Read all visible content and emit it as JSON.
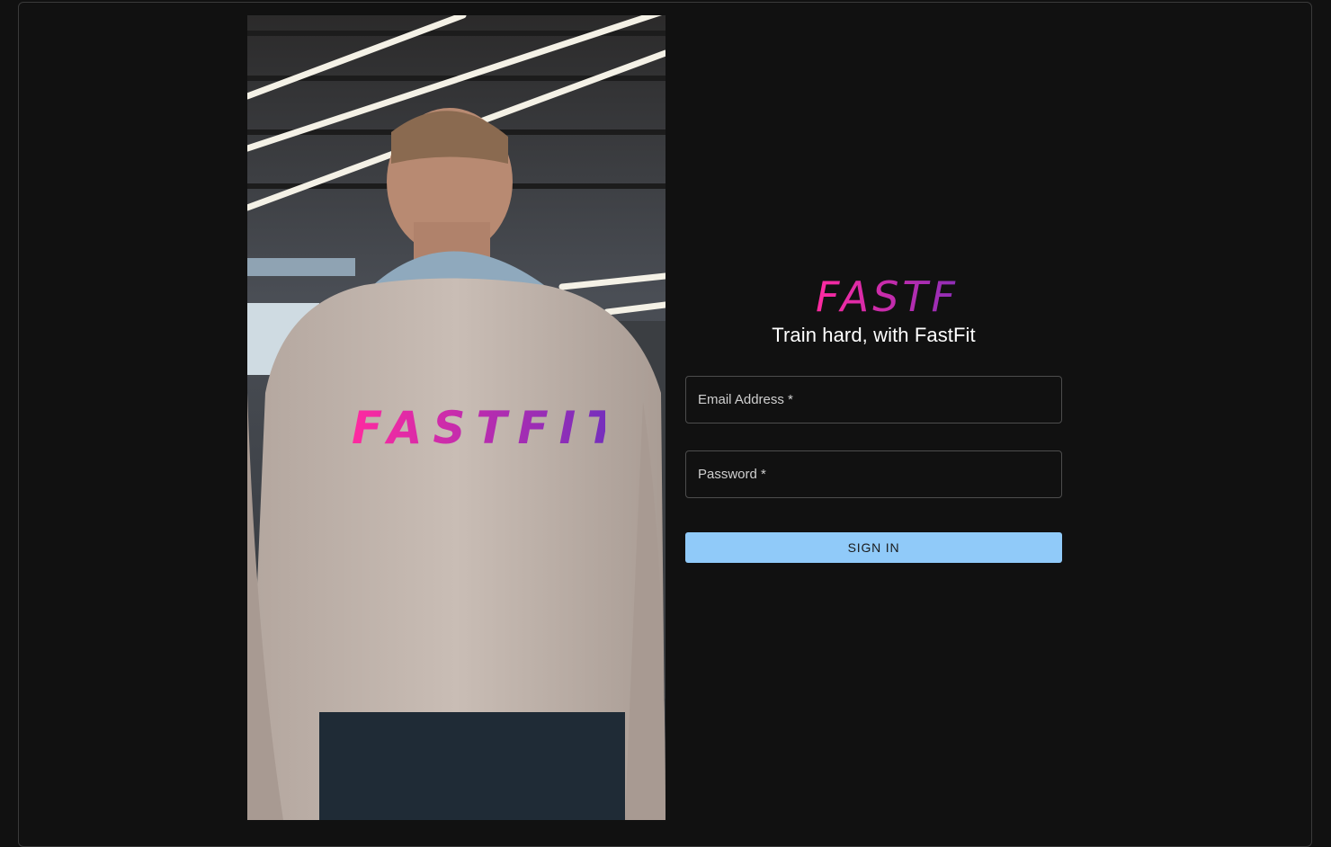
{
  "brand": {
    "logo_text": "FASTFIT",
    "tagline": "Train hard, with FastFit",
    "gradient_start": "#ff2aa0",
    "gradient_end": "#6a2fbf"
  },
  "form": {
    "email_label": "Email Address *",
    "password_label": "Password *",
    "signin_label": "SIGN IN",
    "button_color": "#90caf9"
  },
  "hero_image": {
    "shirt_logo_text": "FASTFIT"
  }
}
